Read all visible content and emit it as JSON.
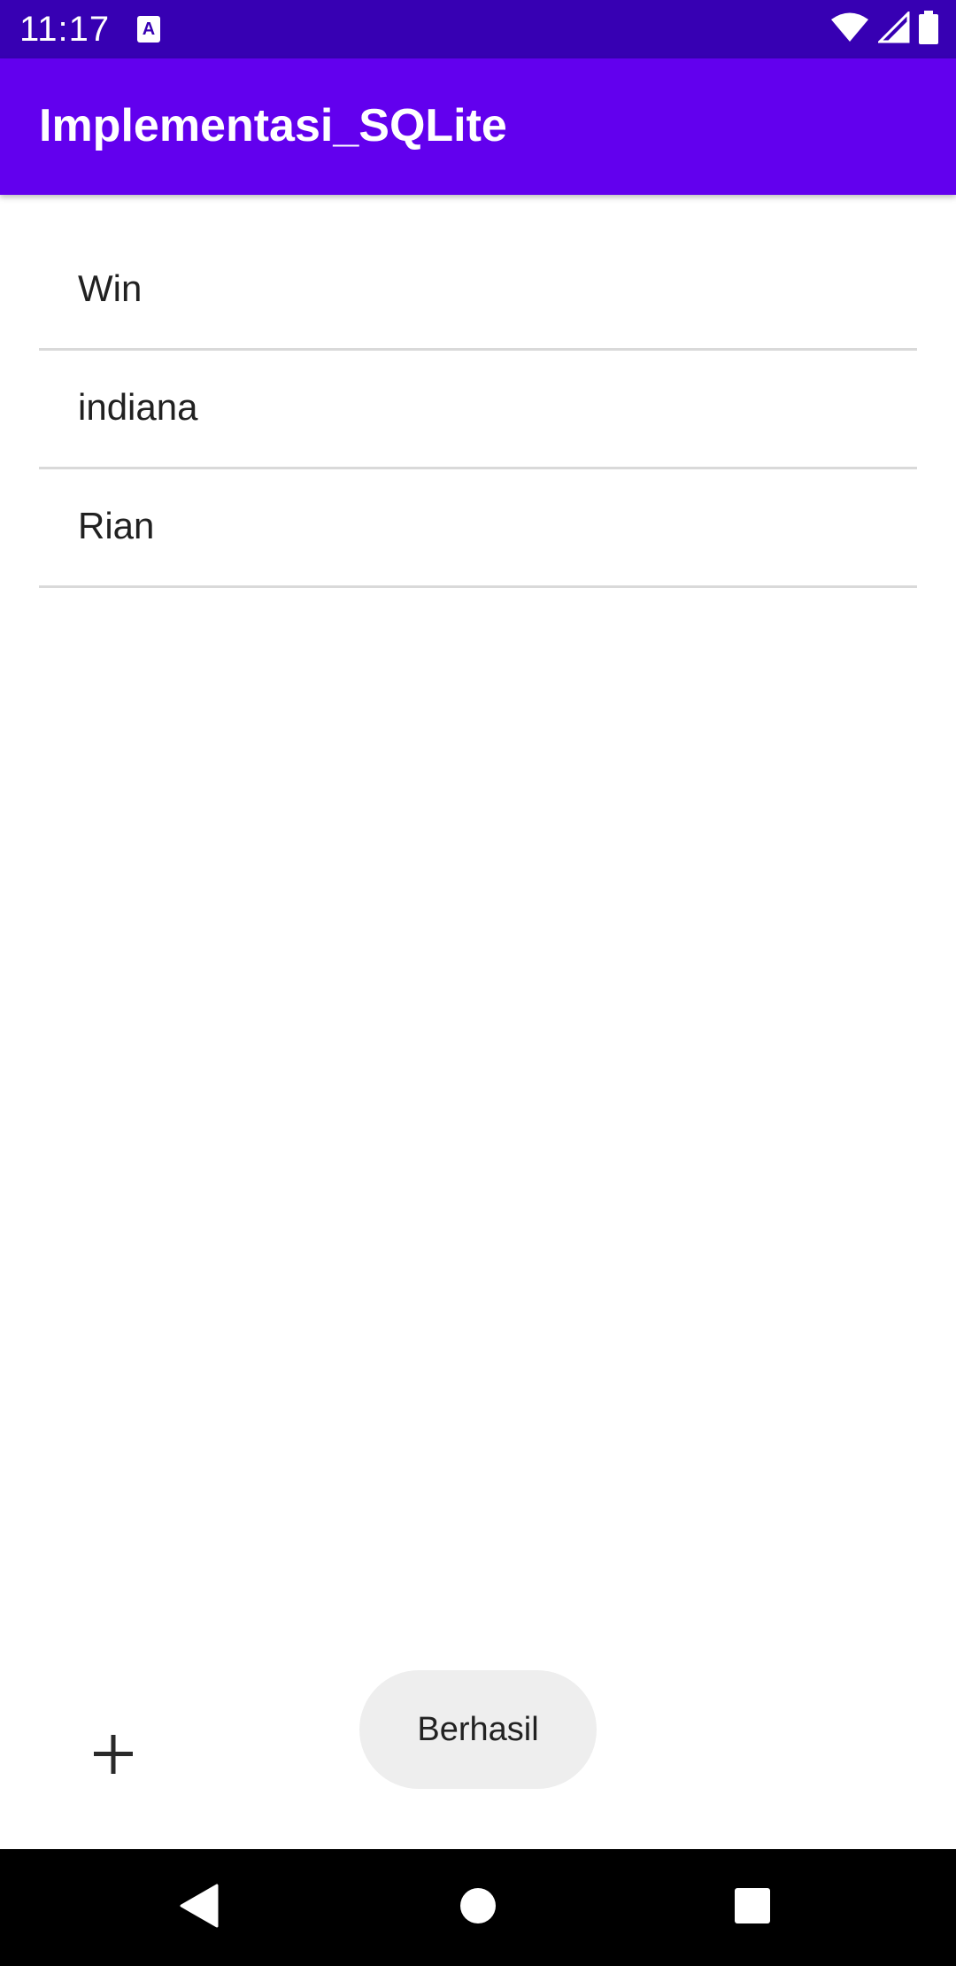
{
  "status_bar": {
    "time": "11:17",
    "notification_icon": "text-notification-icon",
    "notification_glyph": "A",
    "wifi_icon": "wifi-icon",
    "signal_icon": "cell-signal-icon",
    "battery_icon": "battery-icon",
    "background_color": "#3700B3"
  },
  "app_bar": {
    "title": "Implementasi_SQLite",
    "background_color": "#6200EE"
  },
  "list": {
    "items": [
      {
        "label": "Win"
      },
      {
        "label": "indiana"
      },
      {
        "label": "Rian"
      }
    ]
  },
  "fab": {
    "icon": "plus-icon"
  },
  "toast": {
    "message": "Berhasil"
  },
  "nav_bar": {
    "back_icon": "back-triangle-icon",
    "home_icon": "home-circle-icon",
    "recents_icon": "recents-square-icon"
  }
}
